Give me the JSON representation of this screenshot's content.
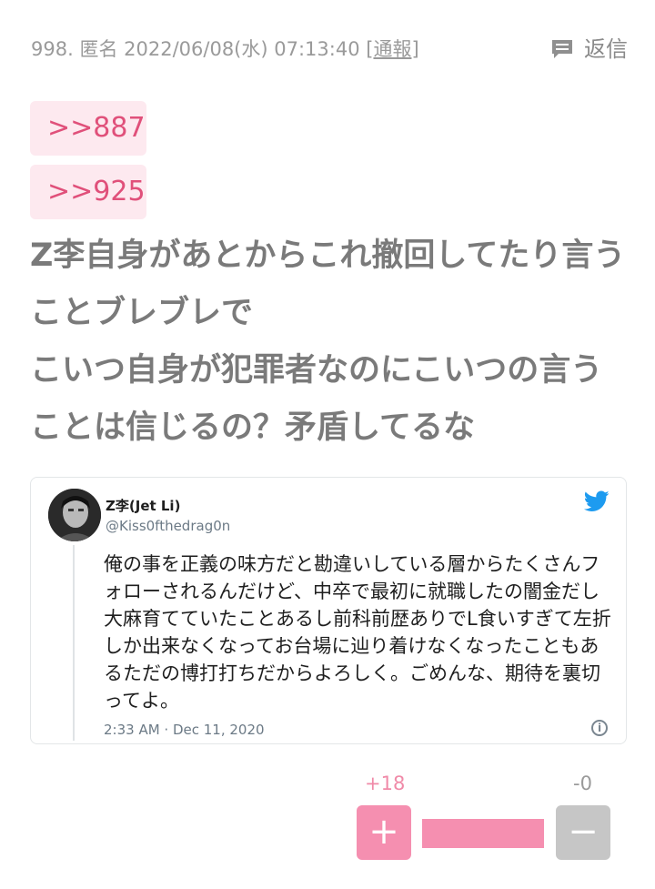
{
  "post": {
    "number": "998.",
    "author": "匿名",
    "datetime": "2022/06/08(水) 07:13:40",
    "report_open": "[",
    "report_label": "通報",
    "report_close": "]",
    "reply_label": "返信",
    "anchors": [
      ">>887",
      ">>925"
    ],
    "body": "Z李自身があとからこれ撤回してたり言うことブレブレで\nこいつ自身が犯罪者なのにこいつの言うことは信じるの？矛盾してるな"
  },
  "tweet": {
    "name": "Z李(Jet Li)",
    "handle": "@Kiss0fthedrag0n",
    "text": "俺の事を正義の味方だと勘違いしている層からたくさんフォローされるんだけど、中卒で最初に就職したの闇金だし大麻育てていたことあるし前科前歴ありでL食いすぎて左折しか出来なくなってお台場に辿り着けなくなったこともあるただの博打打ちだからよろしく。ごめんな、期待を裏切ってよ。",
    "timestamp": "2:33 AM · Dec 11, 2020",
    "info_icon": "i"
  },
  "votes": {
    "plus_count": "+18",
    "minus_count": "-0",
    "plus_label": "+",
    "minus_label": "−",
    "plus_ratio": 1.0
  },
  "colors": {
    "accent_pink": "#f58fb0",
    "anchor_bg": "#fde9ef",
    "anchor_text": "#e0507a",
    "twitter_blue": "#1d9bf0"
  }
}
